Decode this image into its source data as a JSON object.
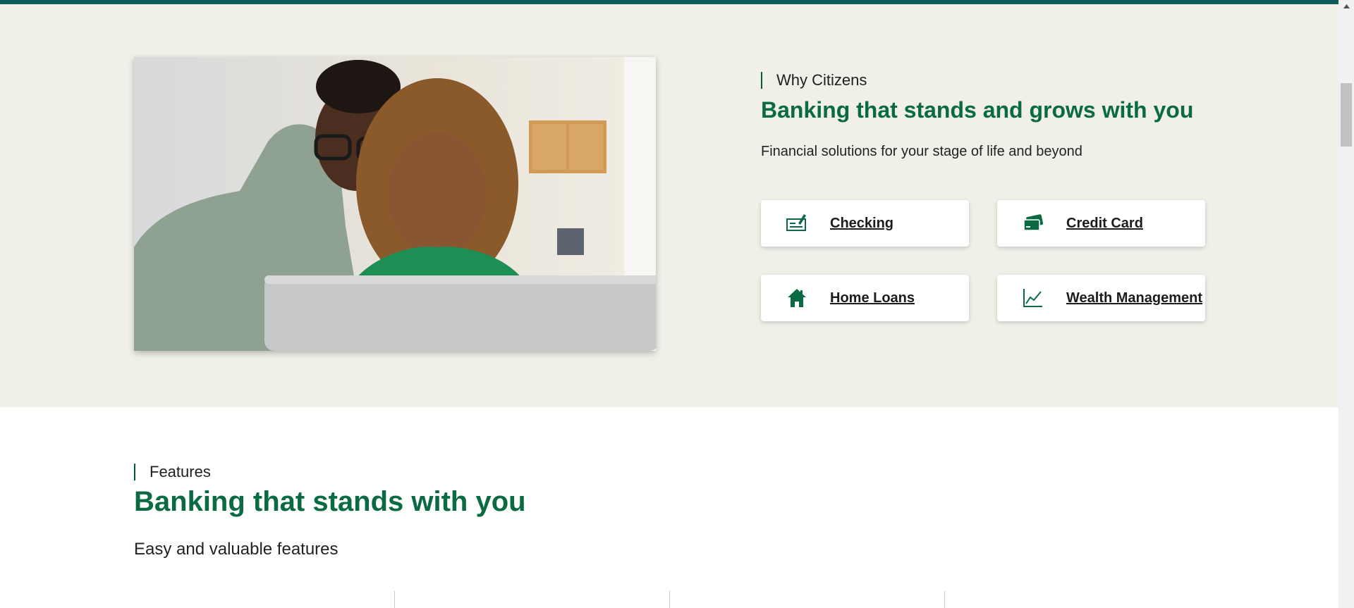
{
  "why_section": {
    "eyebrow": "Why Citizens",
    "title": "Banking that stands and grows with you",
    "subtitle": "Financial solutions for your stage of life and beyond",
    "cards": [
      {
        "label": "Checking",
        "icon": "check-icon"
      },
      {
        "label": "Credit Card",
        "icon": "credit-card-icon"
      },
      {
        "label": "Home Loans",
        "icon": "home-icon"
      },
      {
        "label": "Wealth Management",
        "icon": "chart-line-icon"
      }
    ]
  },
  "features_section": {
    "eyebrow": "Features",
    "title": "Banking that stands with you",
    "subtitle": "Easy and valuable features"
  },
  "colors": {
    "brand_green": "#0a6b43",
    "top_bar": "#0c5c5c",
    "section_bg": "#f0efe8"
  }
}
